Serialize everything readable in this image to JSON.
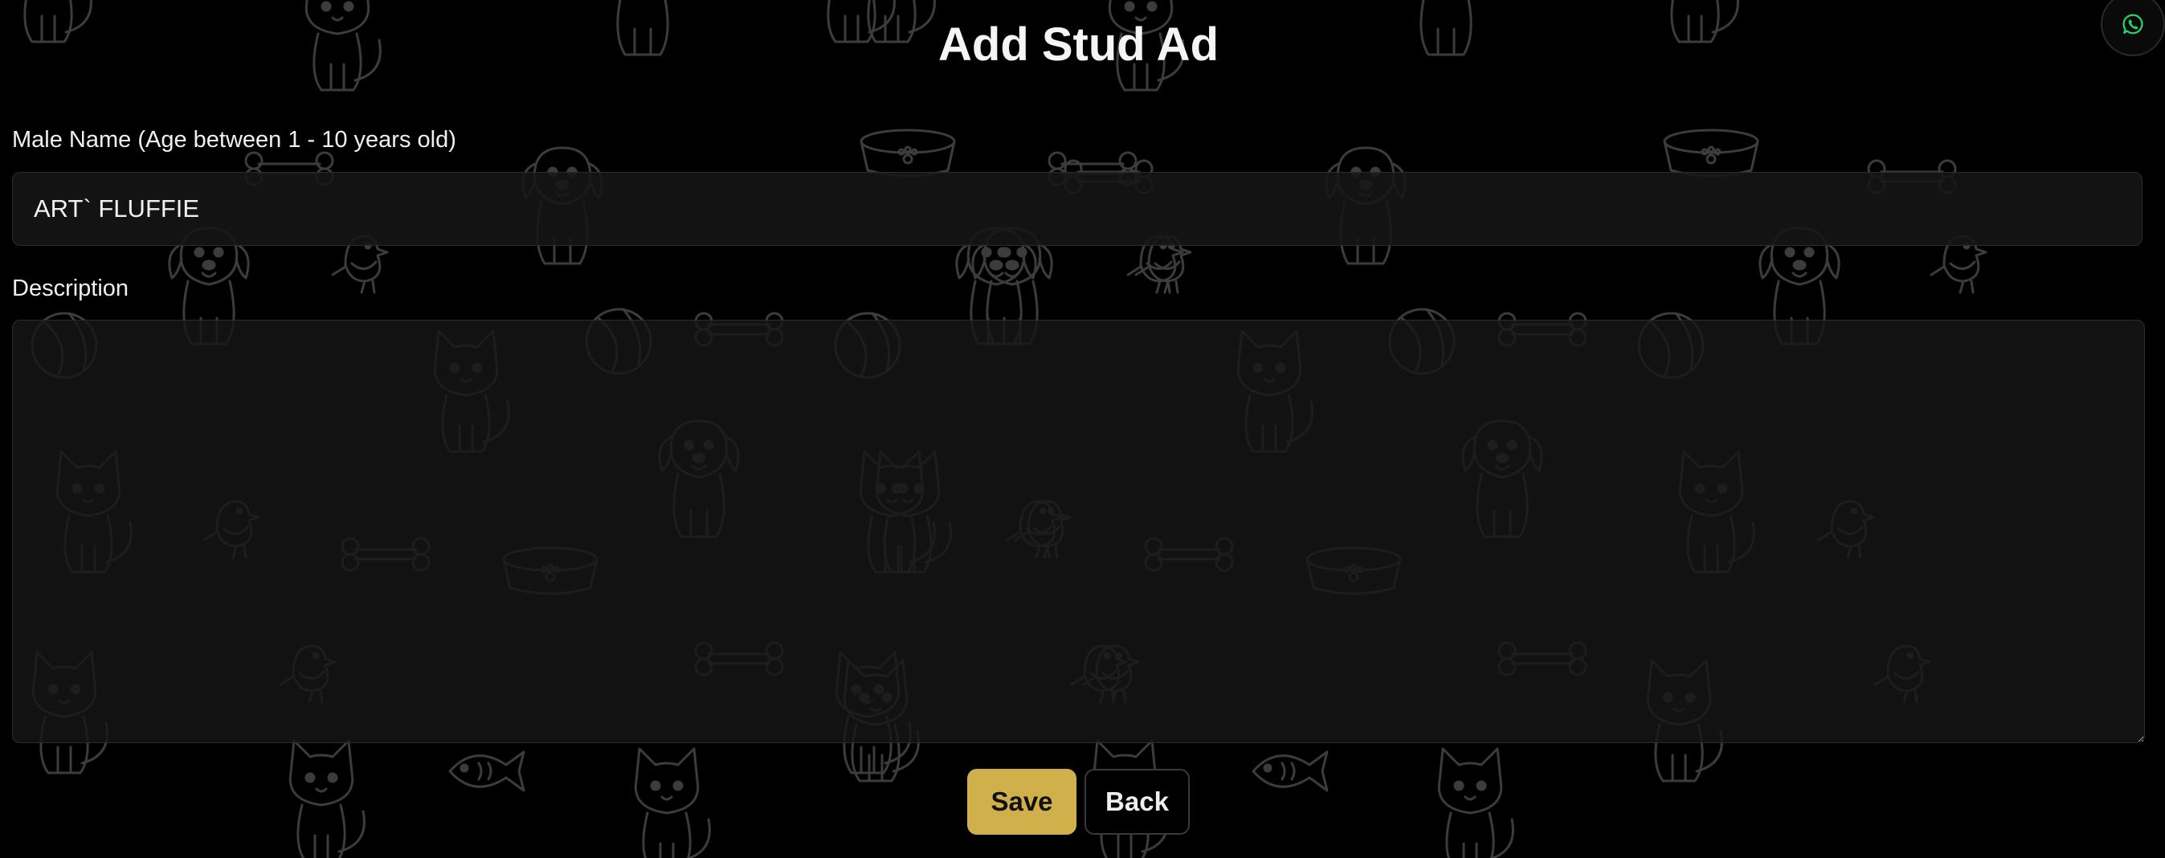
{
  "page": {
    "title": "Add Stud Ad"
  },
  "form": {
    "name_label": "Male Name (Age between 1 - 10 years old)",
    "name_value": "ART` FLUFFIE",
    "description_label": "Description",
    "description_value": ""
  },
  "actions": {
    "save_label": "Save",
    "back_label": "Back"
  },
  "floating": {
    "whatsapp_icon": "whatsapp-icon"
  },
  "background": {
    "pattern": "pet doodles (cats, dogs, bones, bowls, balls, birds, fish)"
  },
  "colors": {
    "background": "#000000",
    "accent": "#d0b04a",
    "whatsapp": "#25d366",
    "doodle_stroke": "#3c3c3c"
  }
}
